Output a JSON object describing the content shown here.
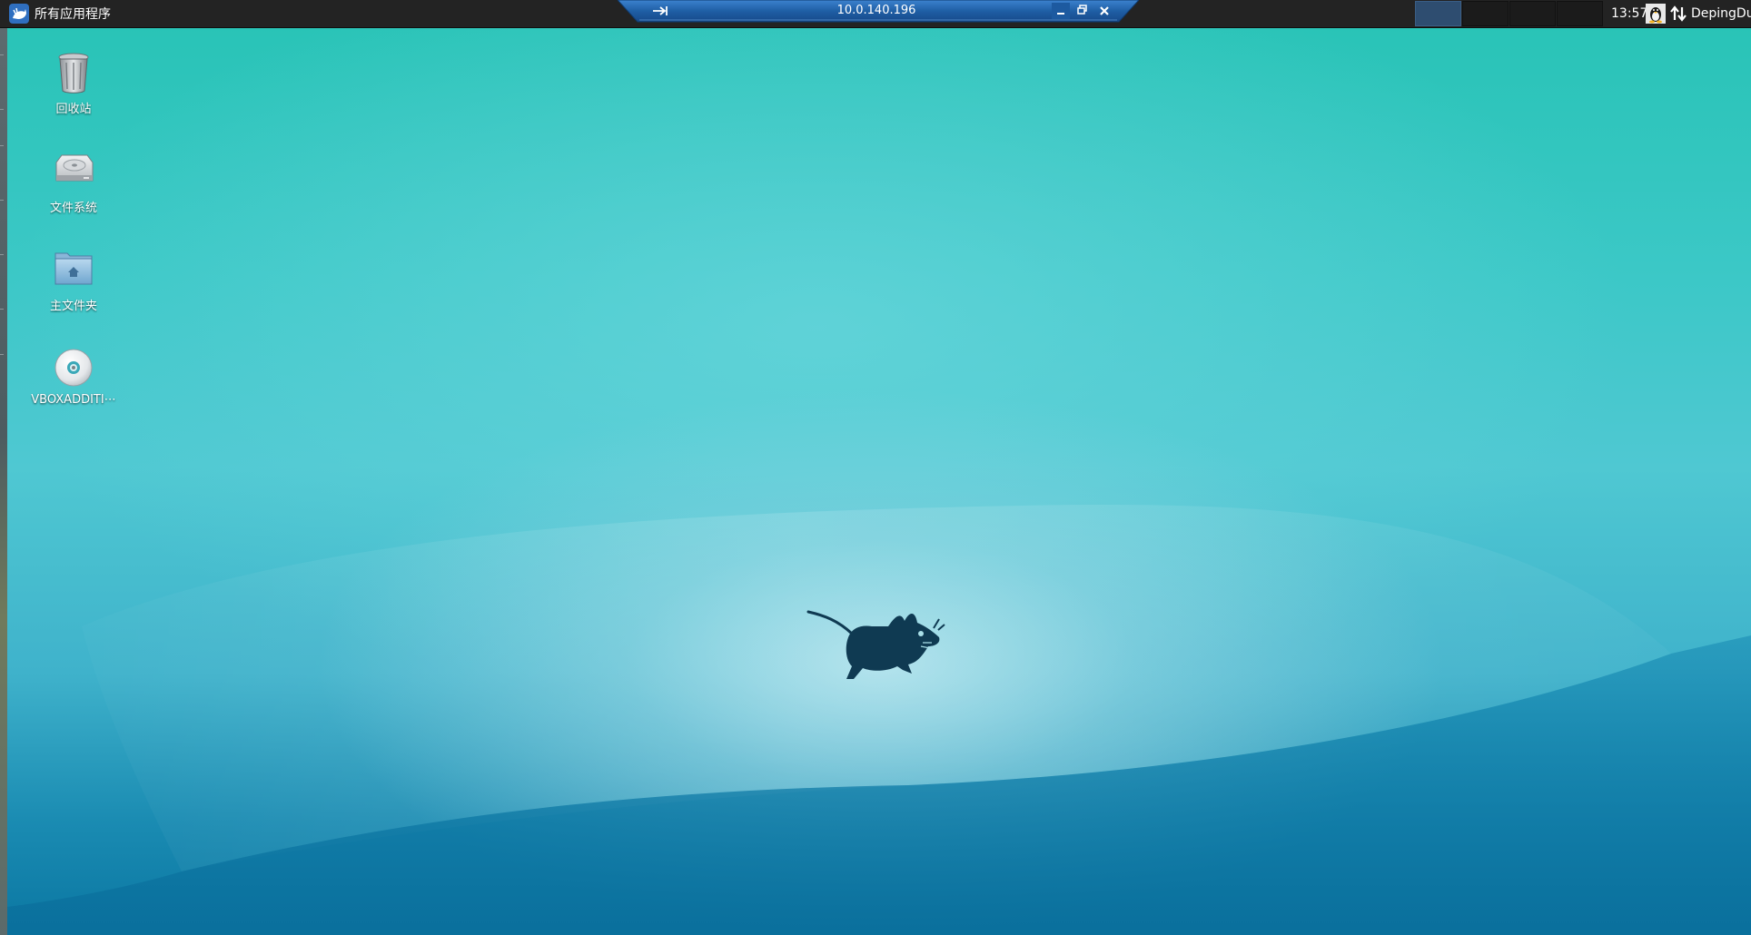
{
  "panel": {
    "apps_menu_label": "所有应用程序",
    "clock": "13:57",
    "user_name": "DepingDu",
    "workspaces": [
      {
        "active": true
      },
      {
        "active": false
      },
      {
        "active": false
      },
      {
        "active": false
      }
    ]
  },
  "connection_bar": {
    "title": "10.0.140.196"
  },
  "desktop_icons": [
    {
      "label": "回收站",
      "icon": "trash-icon"
    },
    {
      "label": "文件系统",
      "icon": "hard-drive-icon"
    },
    {
      "label": "主文件夹",
      "icon": "home-folder-icon"
    },
    {
      "label": "VBOXADDITI⋯",
      "icon": "optical-disc-icon"
    }
  ],
  "colors": {
    "panel_bg": "#232323",
    "active_workspace": "#2e4d70",
    "connection_bar": "#1f5fa5",
    "desktop_top": "#27c3b5",
    "desktop_bottom": "#0b77a2",
    "mascot": "#0f3a52"
  }
}
